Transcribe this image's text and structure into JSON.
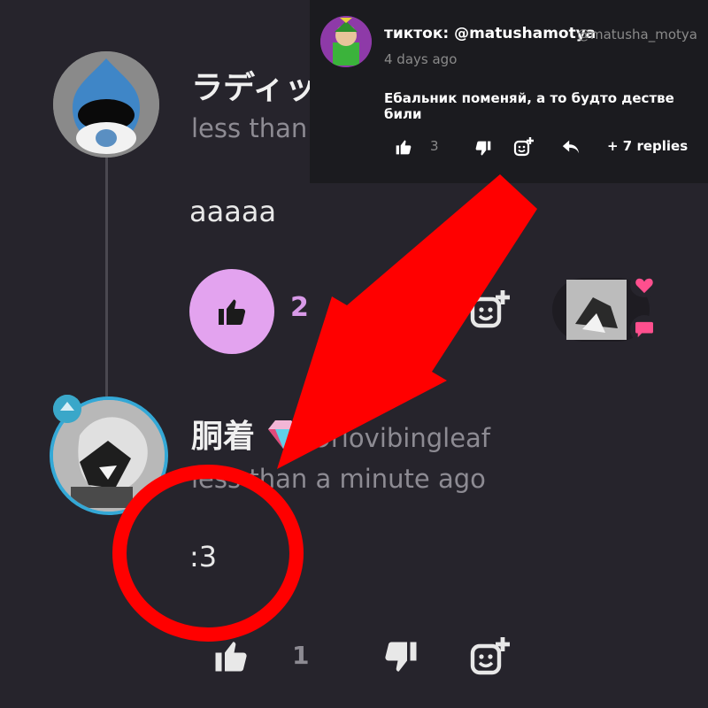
{
  "comment1": {
    "author": "ラディッ",
    "timestamp": "less than",
    "text": "aaaaa",
    "like_count": "2"
  },
  "comment2": {
    "author": "胴着",
    "handle": "Oriovibingleaf",
    "timestamp": "less than a minute ago",
    "text": ":3",
    "like_count": "1"
  },
  "popup": {
    "username": "тикток: @matushamotya",
    "handle": "@matusha_motya",
    "timestamp": "4 days ago",
    "text": "Ебальник поменяй, а то будто дестве били",
    "like_count": "3",
    "replies_label": "+ 7 replies"
  },
  "colors": {
    "background": "#26242c",
    "like_active": "#e3a3ef",
    "annotation_red": "#ff0000",
    "avatar_ring": "#34a8d6"
  },
  "icons": [
    "thumbs-up-icon",
    "thumbs-down-icon",
    "add-reaction-icon",
    "reply-icon",
    "heart-icon",
    "chat-icon"
  ]
}
